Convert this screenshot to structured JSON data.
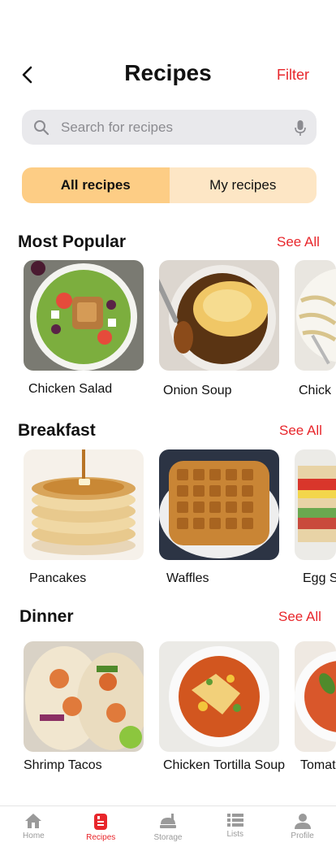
{
  "header": {
    "title": "Recipes",
    "filter_label": "Filter"
  },
  "search": {
    "placeholder": "Search for recipes",
    "value": ""
  },
  "segments": {
    "all": "All recipes",
    "mine": "My recipes",
    "active": "all"
  },
  "sections": {
    "popular": {
      "title": "Most Popular",
      "see_all": "See All",
      "items": [
        "Chicken Salad",
        "Onion Soup",
        "Chick"
      ]
    },
    "breakfast": {
      "title": "Breakfast",
      "see_all": "See All",
      "items": [
        "Pancakes",
        "Waffles",
        "Egg S"
      ]
    },
    "dinner": {
      "title": "Dinner",
      "see_all": "See All",
      "items": [
        "Shrimp Tacos",
        "Chicken Tortilla Soup",
        "Tomat"
      ]
    }
  },
  "nav": {
    "home": "Home",
    "recipes": "Recipes",
    "storage": "Storage",
    "lists": "Lists",
    "profile": "Profile",
    "active": "recipes"
  },
  "colors": {
    "accent": "#e8262b",
    "segment_active": "#fdcd85",
    "segment_bg": "#fde6c5",
    "search_bg": "#e9e9ec"
  },
  "icons": {
    "back": "chevron-left-icon",
    "search": "search-icon",
    "mic": "microphone-icon",
    "home": "home-icon",
    "recipes": "recipe-book-icon",
    "storage": "storage-icon",
    "lists": "list-icon",
    "profile": "profile-icon"
  }
}
